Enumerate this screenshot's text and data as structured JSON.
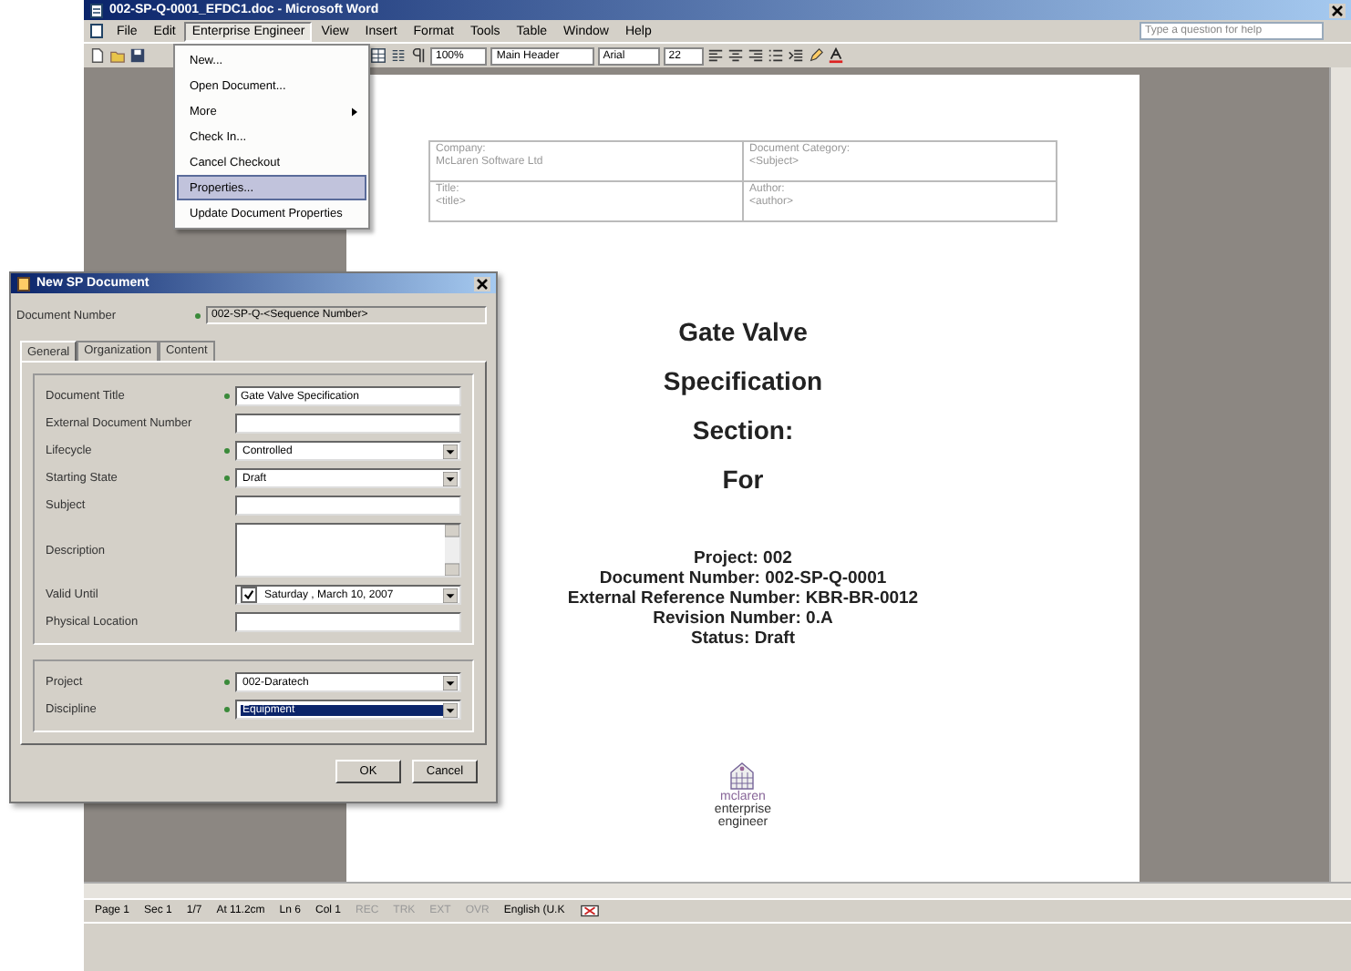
{
  "word": {
    "title": "002-SP-Q-0001_EFDC1.doc - Microsoft Word",
    "menus": [
      {
        "label": "File",
        "selected": false
      },
      {
        "label": "Edit",
        "selected": false
      },
      {
        "label": "Enterprise Engineer",
        "selected": true
      },
      {
        "label": "View",
        "selected": false
      },
      {
        "label": "Insert",
        "selected": false
      },
      {
        "label": "Format",
        "selected": false
      },
      {
        "label": "Tools",
        "selected": false
      },
      {
        "label": "Table",
        "selected": false
      },
      {
        "label": "Window",
        "selected": false
      },
      {
        "label": "Help",
        "selected": false
      }
    ],
    "help_placeholder": "Type a question for help",
    "toolbar": {
      "zoom": "100%",
      "style": "Main Header",
      "font": "Arial",
      "size": "22"
    }
  },
  "menu_popup": {
    "items": [
      {
        "label": "New...",
        "submenu": false,
        "selected": false
      },
      {
        "label": "Open Document...",
        "submenu": false,
        "selected": false
      },
      {
        "label": "More",
        "submenu": true,
        "selected": false
      },
      {
        "label": "Check In...",
        "submenu": false,
        "selected": false
      },
      {
        "label": "Cancel Checkout",
        "submenu": false,
        "selected": false
      },
      {
        "label": "Properties...",
        "submenu": false,
        "selected": true
      },
      {
        "label": "Update Document Properties",
        "submenu": false,
        "selected": false
      }
    ]
  },
  "document": {
    "header_table": [
      [
        {
          "label": "Company:",
          "value": "McLaren Software Ltd"
        },
        {
          "label": "Document Category:",
          "value": "<Subject>"
        }
      ],
      [
        {
          "label": "Title:",
          "value": "<title>"
        },
        {
          "label": "Author:",
          "value": "<author>"
        }
      ]
    ],
    "title_lines": [
      "Gate Valve",
      "Specification",
      "Section:",
      "For"
    ],
    "details": [
      "Project: 002",
      "Document Number: 002-SP-Q-0001",
      "External Reference Number: KBR-BR-0012",
      "Revision Number: 0.A",
      "Status: Draft"
    ],
    "logo": [
      "mclaren",
      "enterprise",
      "engineer"
    ]
  },
  "status_bar": [
    {
      "text": "Page 1",
      "disabled": false
    },
    {
      "text": "Sec 1",
      "disabled": false
    },
    {
      "text": "1/7",
      "disabled": false
    },
    {
      "text": "At 11.2cm",
      "disabled": false
    },
    {
      "text": "Ln 6",
      "disabled": false
    },
    {
      "text": "Col 1",
      "disabled": false
    },
    {
      "text": "REC",
      "disabled": true
    },
    {
      "text": "TRK",
      "disabled": true
    },
    {
      "text": "EXT",
      "disabled": true
    },
    {
      "text": "OVR",
      "disabled": true
    },
    {
      "text": "English (U.K",
      "disabled": false
    }
  ],
  "dialog": {
    "title": "New SP Document",
    "number_label": "Document Number",
    "number_value": "002-SP-Q-<Sequence Number>",
    "tabs": [
      {
        "label": "General",
        "selected": true
      },
      {
        "label": "Organization",
        "selected": false
      },
      {
        "label": "Content",
        "selected": false
      }
    ],
    "fields": [
      {
        "label": "Document Title",
        "kind": "text",
        "required": true,
        "value": "Gate Valve Specification"
      },
      {
        "label": "External Document Number",
        "kind": "text",
        "required": false
      },
      {
        "label": "Lifecycle",
        "kind": "combo",
        "required": true,
        "value": "Controlled",
        "highlighted": false
      },
      {
        "label": "Starting State",
        "kind": "combo",
        "required": true,
        "value": "Draft",
        "highlighted": false
      },
      {
        "label": "Subject",
        "kind": "text",
        "required": false
      },
      {
        "label": "Description",
        "kind": "memo",
        "required": false
      },
      {
        "label": "Valid Until",
        "kind": "date",
        "required": false,
        "checked": true,
        "value": "Saturday ,  March  10, 2007"
      },
      {
        "label": "Physical Location",
        "kind": "text",
        "required": false
      }
    ],
    "org_fields": [
      {
        "label": "Project",
        "kind": "combo",
        "required": true,
        "value": "002-Daratech",
        "highlighted": false
      },
      {
        "label": "Discipline",
        "kind": "combo",
        "required": true,
        "value": "Equipment",
        "highlighted": true
      }
    ],
    "buttons": [
      "OK",
      "Cancel"
    ]
  }
}
